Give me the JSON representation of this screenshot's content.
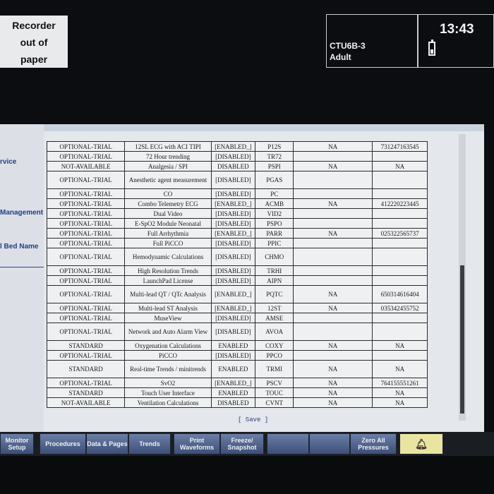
{
  "recorder": {
    "line1": "Recorder",
    "line2": "out of",
    "line3": "paper"
  },
  "bed": {
    "name": "CTU6B-3",
    "patient_type": "Adult"
  },
  "clock": {
    "time": "13:43"
  },
  "left_menu": [
    {
      "label": "rvice"
    },
    {
      "label": "Management"
    },
    {
      "label": "l Bed Name"
    }
  ],
  "table": {
    "rows": [
      [
        "OPTIONAL-TRIAL",
        "12SL ECG with ACI TIPI",
        "[ENABLED_]",
        "P12S",
        "NA",
        "731247163545"
      ],
      [
        "OPTIONAL-TRIAL",
        "72 Hour trending",
        "[DISABLED]",
        "TR72",
        "",
        ""
      ],
      [
        "NOT-AVAILABLE",
        "Analgesia / SPI",
        "DISABLED",
        "PSPI",
        "NA",
        "NA"
      ],
      [
        "OPTIONAL-TRIAL",
        "Anesthetic agent measurement",
        "[DISABLED]",
        "PGAS",
        "",
        ""
      ],
      [
        "OPTIONAL-TRIAL",
        "CO",
        "[DISABLED]",
        "PC",
        "",
        ""
      ],
      [
        "OPTIONAL-TRIAL",
        "Combo Telemetry ECG",
        "[ENABLED_]",
        "ACMB",
        "NA",
        "412220223445"
      ],
      [
        "OPTIONAL-TRIAL",
        "Dual Video",
        "[DISABLED]",
        "VID2",
        "",
        ""
      ],
      [
        "OPTIONAL-TRIAL",
        "E-SpO2 Module Neonatal",
        "[DISABLED]",
        "PSPO",
        "",
        ""
      ],
      [
        "OPTIONAL-TRIAL",
        "Full Arrhythmia",
        "[ENABLED_]",
        "PARR",
        "NA",
        "025322565737"
      ],
      [
        "OPTIONAL-TRIAL",
        "Full PiCCO",
        "[DISABLED]",
        "PPIC",
        "",
        ""
      ],
      [
        "OPTIONAL-TRIAL",
        "Hemodynamic Calculations",
        "[DISABLED]",
        "CHMO",
        "",
        ""
      ],
      [
        "OPTIONAL-TRIAL",
        "High Resolution Trends",
        "[DISABLED]",
        "TRHI",
        "",
        ""
      ],
      [
        "OPTIONAL-TRIAL",
        "LaunchPad License",
        "[DISABLED]",
        "AIPN",
        "",
        ""
      ],
      [
        "OPTIONAL-TRIAL",
        "Multi-lead QT / QTc Analysis",
        "[ENABLED_]",
        "PQTC",
        "NA",
        "650314616404"
      ],
      [
        "OPTIONAL-TRIAL",
        "Multi-lead ST Analysis",
        "[ENABLED_]",
        "12ST",
        "NA",
        "035342455752"
      ],
      [
        "OPTIONAL-TRIAL",
        "MuseView",
        "[DISABLED]",
        "AMSE",
        "",
        ""
      ],
      [
        "OPTIONAL-TRIAL",
        "Network and Auto Alarm View",
        "[DISABLED]",
        "AVOA",
        "",
        ""
      ],
      [
        "STANDARD",
        "Oxygenation Calculations",
        "ENABLED",
        "COXY",
        "NA",
        "NA"
      ],
      [
        "OPTIONAL-TRIAL",
        "PiCCO",
        "[DISABLED]",
        "PPCO",
        "",
        ""
      ],
      [
        "STANDARD",
        "Real-time Trends / minitrends",
        "ENABLED",
        "TRMI",
        "NA",
        "NA"
      ],
      [
        "OPTIONAL-TRIAL",
        "SvO2",
        "[ENABLED_]",
        "PSCV",
        "NA",
        "764155551261"
      ],
      [
        "STANDARD",
        "Touch User Interface",
        "ENABLED",
        "TOUC",
        "NA",
        "NA"
      ],
      [
        "NOT-AVAILABLE",
        "Ventilation Calculations",
        "DISABLED",
        "CVNT",
        "NA",
        "NA"
      ]
    ]
  },
  "save_label": "[ Save ]",
  "softkeys": [
    {
      "label": "Monitor Setup"
    },
    {
      "label": "Procedures"
    },
    {
      "label": "Data & Pages"
    },
    {
      "label": "Trends"
    },
    {
      "label": "Print Waveforms"
    },
    {
      "label": "Freeze/ Snapshot"
    },
    {
      "label": ""
    },
    {
      "label": ""
    },
    {
      "label": "Zero All Pressures"
    }
  ],
  "icons": {
    "alarm": "bell-icon",
    "battery": "battery-icon",
    "cursor": "x-cursor-icon"
  },
  "colors": {
    "alarm_key": "#e9e5a0",
    "softkey": "#4f6290",
    "link": "#1f3d8a"
  }
}
